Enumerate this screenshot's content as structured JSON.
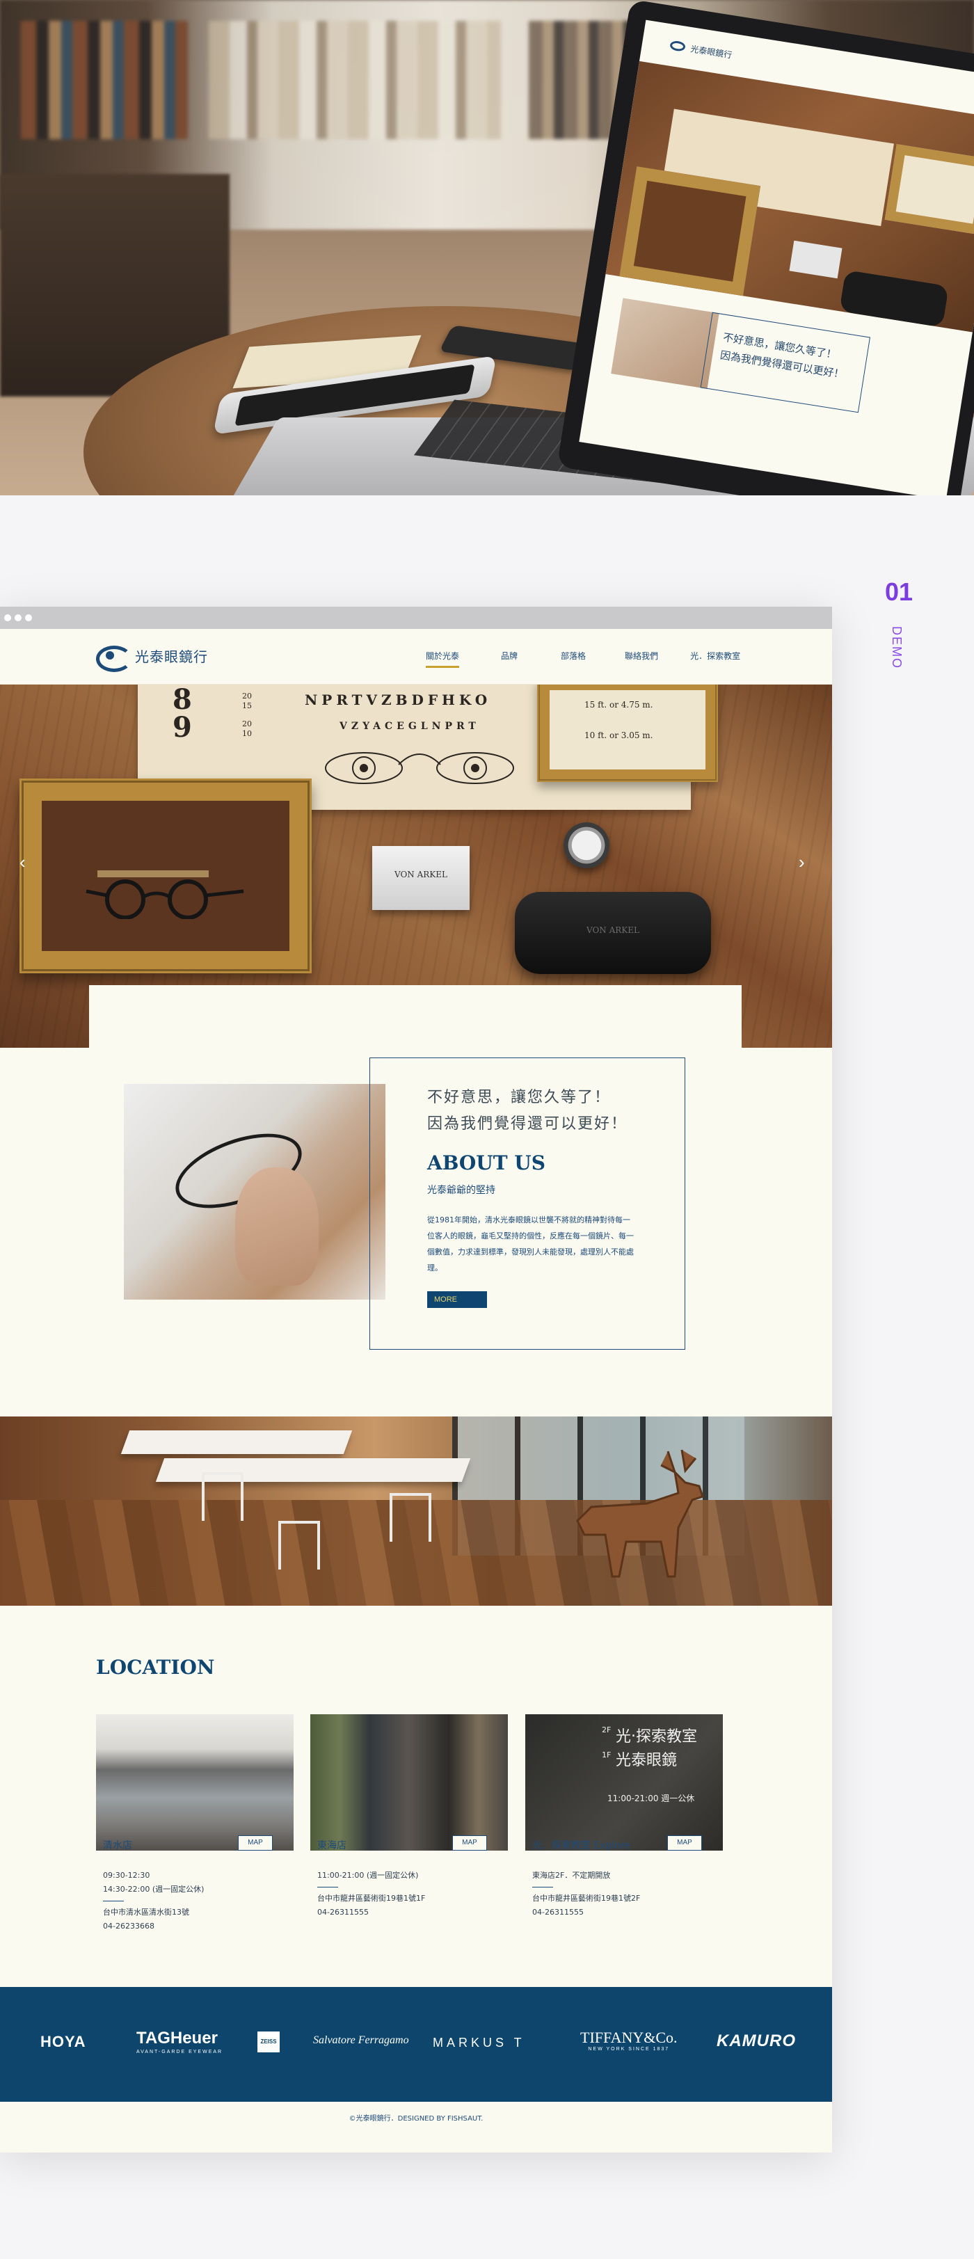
{
  "hero_mockup": {
    "screen_logo": "光泰眼鏡行",
    "screen_message": [
      "不好意思，讓您久等了！",
      "因為我們覺得還可以更好！"
    ]
  },
  "demo": {
    "number": "01",
    "label": "DEMO"
  },
  "site": {
    "logo_text": "光泰眼鏡行",
    "nav": [
      {
        "label": "關於光泰",
        "active": true
      },
      {
        "label": "品牌",
        "active": false
      },
      {
        "label": "部落格",
        "active": false
      },
      {
        "label": "聯絡我們",
        "active": false
      },
      {
        "label": "光．探索教室",
        "active": false
      }
    ],
    "slider": {
      "eyechart_big": [
        "8",
        "9"
      ],
      "eyechart_small": [
        "20",
        "15",
        "20",
        "10"
      ],
      "eyechart_row1": "NPRTVZBDFHKO",
      "eyechart_row2": "VZYACEGLNPRT",
      "frame_text": [
        "15 ft. or 4.75 m.",
        "10 ft. or 3.05 m."
      ],
      "card_text": "VON ARKEL",
      "case_text": "VON ARKEL",
      "prev_icon": "chevron-left-icon",
      "next_icon": "chevron-right-icon"
    },
    "about": {
      "lead_line1": "不好意思，讓您久等了！",
      "lead_line2": "因為我們覺得還可以更好！",
      "title": "ABOUT US",
      "subtitle": "光泰爺爺的堅持",
      "body": "從1981年開始，清水光泰眼鏡以世襲不將就的精神對待每一位客人的眼鏡，龜毛又堅持的個性，反應在每一個鏡片、每一個數值，力求達到標準，發現別人未能發現，處理別人不能處理。",
      "more_label": "MORE"
    },
    "location": {
      "title": "LOCATION",
      "stores": [
        {
          "name": "清水店",
          "map_label": "MAP",
          "hours": [
            "09:30-12:30",
            "14:30-22:00 (週一固定公休)"
          ],
          "address": "台中市清水區清水街13號",
          "phone": "04-26233668"
        },
        {
          "name": "東海店",
          "map_label": "MAP",
          "hours": [
            "11:00-21:00 (週一固定公休)"
          ],
          "address": "台中市龍井區藝術街19巷1號1F",
          "phone": "04-26311555"
        },
        {
          "name": "光．探索教室 Explore",
          "map_label": "MAP",
          "hours": [
            "東海店2F．不定期開放"
          ],
          "address": "台中市龍井區藝術街19巷1號2F",
          "phone": "04-26311555"
        }
      ],
      "explore_sign": {
        "floor2": "2F",
        "floor1": "1F",
        "line1": "光‧探索教室",
        "line2": "光泰眼鏡",
        "line3": "11:00-21:00 週一公休"
      }
    },
    "brands": [
      "HOYA",
      "TAGHeuer",
      "AVANT-GARDE EYEWEAR",
      "ZEISS",
      "Salvatore Ferragamo",
      "MARKUS T",
      "TIFFANY&Co.",
      "NEW YORK SINCE 1837",
      "KAMURO"
    ],
    "footer": "©光泰眼鏡行．DESIGNED BY FISHSAUT."
  },
  "colors": {
    "navy": "#0d456d",
    "cream": "#fbfaf1",
    "gold": "#c8a12c",
    "purple": "#7c3de0"
  }
}
